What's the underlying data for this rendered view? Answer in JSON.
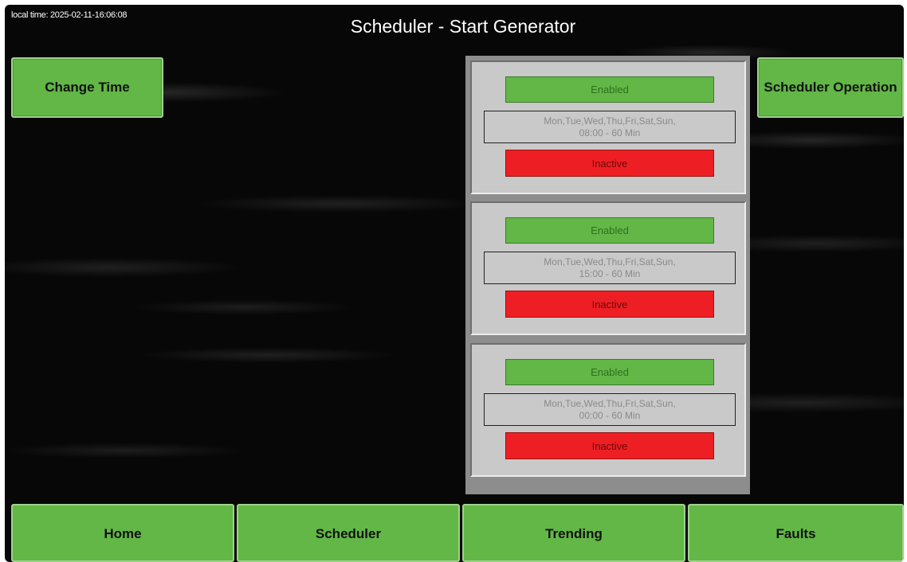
{
  "header": {
    "local_time": "local time: 2025-02-11-16:06:08",
    "title": "Scheduler - Start Generator"
  },
  "buttons": {
    "change_time": "Change Time",
    "scheduler_operation": "Scheduler Operation"
  },
  "schedules": [
    {
      "enabled": "Enabled",
      "days": "Mon,Tue,Wed,Thu,Fri,Sat,Sun,",
      "time": "08:00 - 60 Min",
      "state": "Inactive"
    },
    {
      "enabled": "Enabled",
      "days": "Mon,Tue,Wed,Thu,Fri,Sat,Sun,",
      "time": "15:00 - 60 Min",
      "state": "Inactive"
    },
    {
      "enabled": "Enabled",
      "days": "Mon,Tue,Wed,Thu,Fri,Sat,Sun,",
      "time": "00:00 - 60 Min",
      "state": "Inactive"
    }
  ],
  "nav": {
    "home": "Home",
    "scheduler": "Scheduler",
    "trending": "Trending",
    "faults": "Faults"
  },
  "colors": {
    "button_green": "#62b746",
    "inactive_red": "#ee1f24",
    "background": "#070707"
  }
}
